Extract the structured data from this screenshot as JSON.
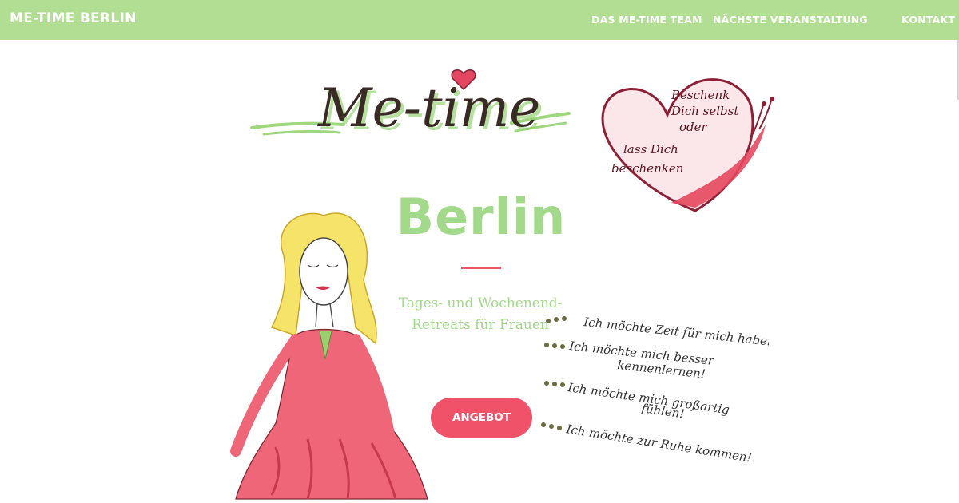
{
  "nav": {
    "brand": "ME-TIME BERLIN",
    "links": [
      {
        "label": "DAS ME-TIME TEAM"
      },
      {
        "label": "NÄCHSTE VERANSTALTUNG"
      },
      {
        "label": "KONTAKT"
      }
    ]
  },
  "hero": {
    "logo_text": "Me-time",
    "title": "Berlin",
    "subtitle": "Tages- und Wochenend-Retreats für Frauen",
    "cta_label": "ANGEBOT",
    "heart_note": [
      "Beschenk",
      "Dich selbst",
      "oder",
      "lass Dich",
      "beschenken"
    ],
    "wishes": [
      "Ich möchte Zeit für mich haben!",
      "Ich möchte mich besser",
      "kennenlernen!",
      "Ich möchte mich großartig",
      "fühlen!",
      "Ich möchte zur Ruhe kommen!"
    ]
  },
  "colors": {
    "navbar": "#b2de93",
    "accent_green": "#a3d98a",
    "accent_red": "#f0526a"
  }
}
